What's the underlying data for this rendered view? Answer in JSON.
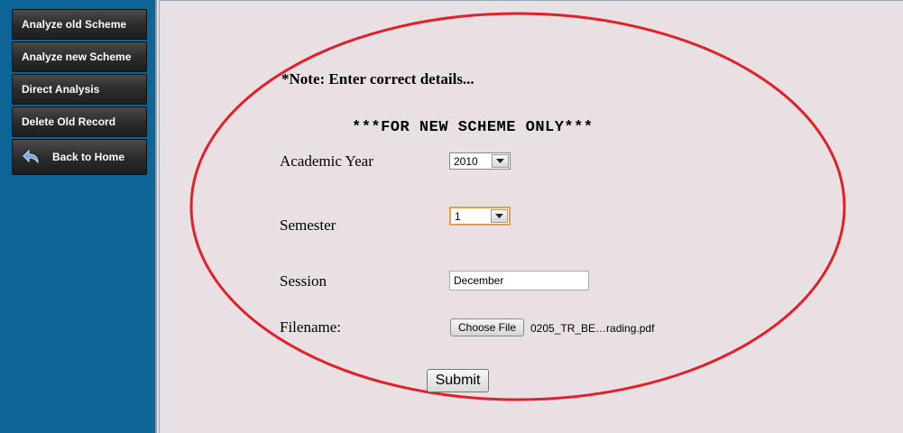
{
  "sidebar": {
    "items": [
      {
        "label": "Analyze old Scheme"
      },
      {
        "label": "Analyze new Scheme"
      },
      {
        "label": "Direct Analysis"
      },
      {
        "label": "Delete Old Record"
      },
      {
        "label": "Back to Home",
        "icon": "back-arrow-icon"
      }
    ]
  },
  "form": {
    "note": "*Note: Enter correct details...",
    "heading": "***FOR NEW SCHEME ONLY***",
    "academic_year_label": "Academic Year",
    "academic_year_value": "2010",
    "semester_label": "Semester",
    "semester_value": "1",
    "session_label": "Session",
    "session_value": "December",
    "filename_label": "Filename:",
    "choose_file_label": "Choose File",
    "file_name": "0205_TR_BE…rading.pdf",
    "submit_label": "Submit"
  },
  "colors": {
    "sidebar_bg": "#0d6497",
    "page_bg": "#e8e0e2",
    "annotation_ellipse": "#e0202a"
  }
}
